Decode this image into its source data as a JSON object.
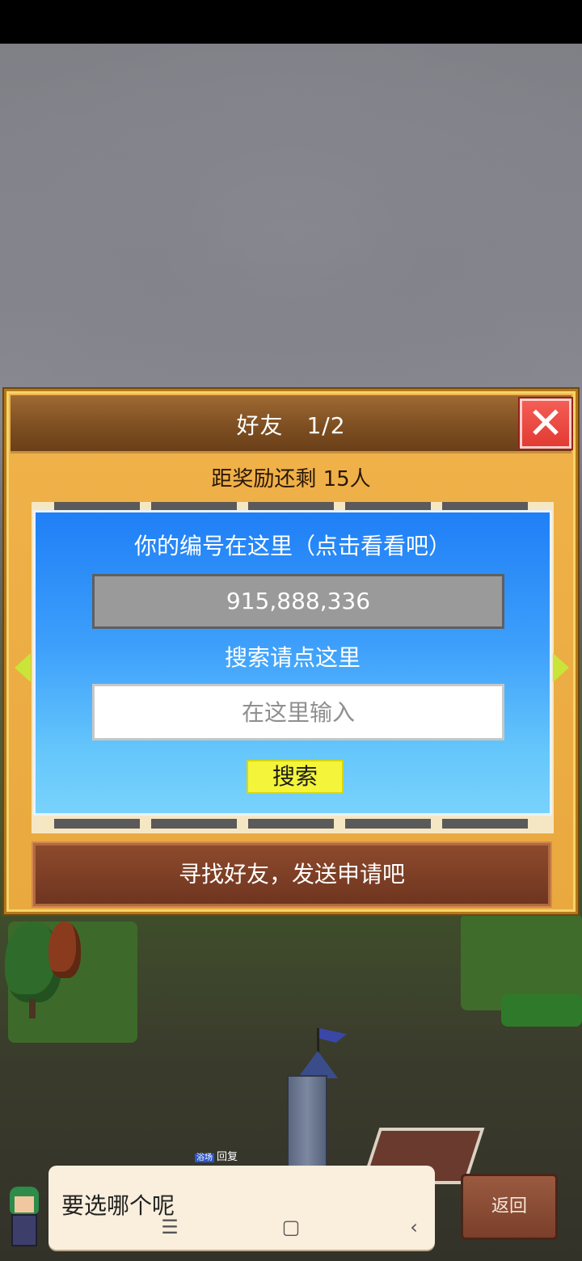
{
  "dialog": {
    "title": "好友　1/2",
    "reward": "距奖励还剩 15人",
    "id_label": "你的编号在这里（点击看看吧）",
    "id_value": "915,888,336",
    "search_label": "搜索请点这里",
    "search_placeholder": "在这里输入",
    "search_button": "搜索",
    "find_friends": "寻找好友，发送申请吧",
    "close_icon": "✕"
  },
  "map": {
    "tag_icon": "浴场",
    "tag_label": "回复"
  },
  "bottom": {
    "speech": "要选哪个呢",
    "back_button": "返回"
  },
  "navbar": {
    "menu_icon": "☰",
    "home_icon": "▢",
    "back_icon": "‹"
  },
  "colors": {
    "panel": "#e9a93f",
    "header": "#7e4f22",
    "card_top": "#1f7ff6",
    "card_bottom": "#78d2fb",
    "close": "#e23b33",
    "search_button": "#f4f43a",
    "find_button": "#6f3520"
  }
}
